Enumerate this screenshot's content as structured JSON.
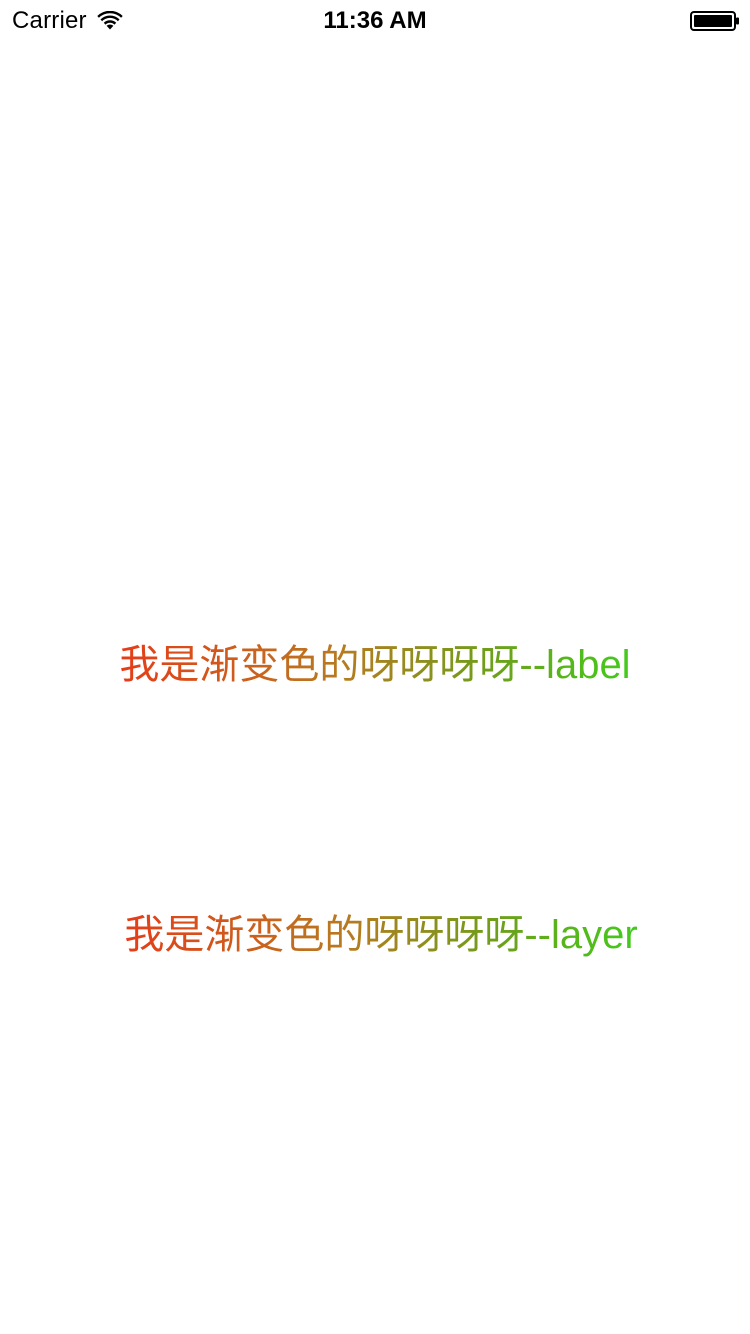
{
  "status_bar": {
    "carrier": "Carrier",
    "time": "11:36 AM",
    "wifi_icon": "wifi-icon",
    "battery_icon": "battery-full-icon"
  },
  "content": {
    "label_text": "我是渐变色的呀呀呀呀--label",
    "layer_text": "我是渐变色的呀呀呀呀--layer"
  },
  "colors": {
    "gradient_start": "#ff1a14",
    "gradient_mid": "#b87a20",
    "gradient_end": "#1df01e",
    "background": "#ffffff"
  }
}
